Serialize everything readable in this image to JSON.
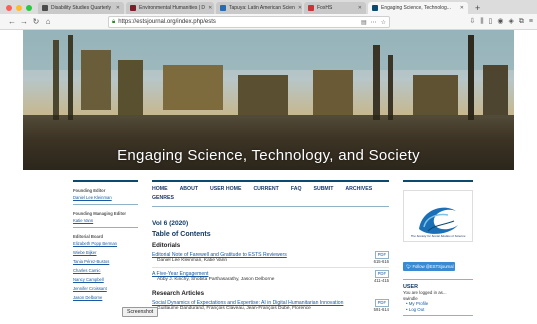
{
  "browser": {
    "tabs": [
      {
        "title": "Disability Studies Quarterly",
        "active": false
      },
      {
        "title": "Environmental Humanities | D",
        "active": false
      },
      {
        "title": "Tapuya: Latin American Scien",
        "active": false
      },
      {
        "title": "FoxHS",
        "active": false
      },
      {
        "title": "Engaging Science, Technolog...",
        "active": true
      }
    ],
    "url": "https://estsjournal.org/index.php/ests",
    "url_icons": [
      "reader-icon",
      "pocket-icon",
      "star-icon"
    ]
  },
  "banner": {
    "title": "Engaging Science, Technology, and Society"
  },
  "left": {
    "founding_editor_heading": "Founding Editor",
    "founding_editor": "Daniel Lee Kleinman",
    "founding_managing_heading": "Founding Managing Editor",
    "founding_managing": "Katie Vann",
    "board_heading": "Editorial Board",
    "board": [
      "Elizabeth Popp Berman",
      "Wiebe Bijker",
      "Tania Pérez-Bustos",
      "Charles Camic",
      "Nancy Campbell",
      "Jennifer Croissant",
      "Jason Delborne"
    ]
  },
  "main": {
    "nav": [
      "HOME",
      "ABOUT",
      "USER HOME",
      "CURRENT",
      "FAQ",
      "SUBMIT",
      "ARCHIVES",
      "GENRES"
    ],
    "volume": "Vol 6 (2020)",
    "toc": "Table of Contents",
    "sections": [
      {
        "name": "Editorials",
        "articles": [
          {
            "title": "Editorial Note of Farewell and Gratitude to ESTS Reviewers",
            "authors": "Daniel Lee Kleinman, Katie Vann",
            "pdf": "PDF",
            "pages": "615-616"
          },
          {
            "title": "A Five-Year Engagement",
            "authors": "Abby J. Kinchy, Shobita Parthasarathy, Jason Delborne",
            "pdf": "PDF",
            "pages": "411-415"
          }
        ]
      },
      {
        "name": "Research Articles",
        "articles": [
          {
            "title": "Social Dynamics of Expectations and Expertise: AI in Digital Humanitarian Innovation",
            "authors": "Guillaume Dandurand, François Claveau, Jean-François Dubé, Florence",
            "pdf": "PDF",
            "pages": "591-614"
          }
        ]
      }
    ]
  },
  "right": {
    "logo_caption": "The Society for Social Studies of Science",
    "twitter": "Follow @ESTSjournal",
    "user_heading": "USER",
    "user_text_1": "You are logged in as...",
    "user_name": "swindle",
    "links": [
      "My Profile",
      "Log Out"
    ]
  },
  "tooltip": "Screenshot"
}
